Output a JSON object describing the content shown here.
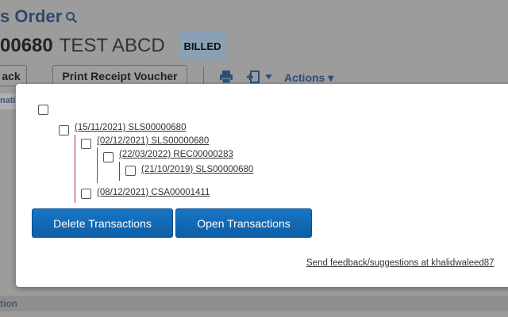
{
  "background": {
    "title": "s Order",
    "record_number": "00680",
    "record_name": "TEST ABCD",
    "status_badge": "BILLED",
    "back_label": "ack",
    "print_label": "Print Receipt Voucher",
    "actions_label": "Actions ▾",
    "left_strip_top": "nati",
    "bottom_strip": "tion"
  },
  "modal": {
    "transactions": [
      {
        "label": "(15/11/2021) SLS00000680",
        "level": 0
      },
      {
        "label": "(02/12/2021) SLS00000680",
        "level": 1
      },
      {
        "label": "(22/03/2022) REC00000283",
        "level": 2
      },
      {
        "label": "(21/10/2019) SLS00000680",
        "level": 3
      },
      {
        "label": "(08/12/2021) CSA00001411",
        "level": 1
      }
    ],
    "delete_button": "Delete Transactions",
    "open_button": "Open Transactions",
    "feedback_text": "Send feedback/suggestions at khalidwaleed87"
  },
  "colors": {
    "primary_button": "#1668b4",
    "tree_line": "#c0262a",
    "badge": "#8aa0b5",
    "title": "#2d4a6b"
  },
  "icons": [
    "search-icon",
    "print-icon",
    "add-document-icon",
    "chevron-down-icon"
  ]
}
